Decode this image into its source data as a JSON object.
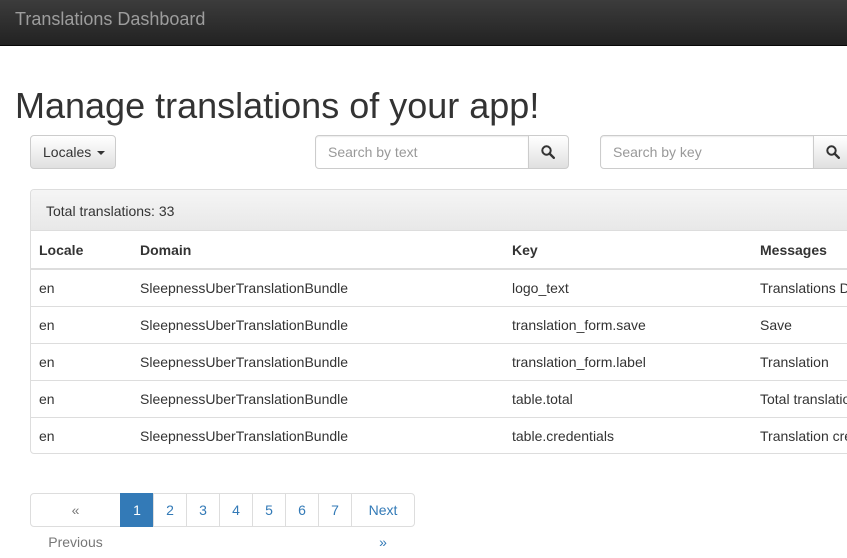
{
  "app": {
    "brand": "Translations Dashboard"
  },
  "page": {
    "title": "Manage translations of your app!"
  },
  "toolbar": {
    "locales_label": "Locales",
    "search_text_placeholder": "Search by text",
    "search_key_placeholder": "Search by key",
    "search_icon": "search-icon"
  },
  "panel": {
    "total_label": "Total translations: 33"
  },
  "table": {
    "columns": [
      "Locale",
      "Domain",
      "Key",
      "Messages"
    ],
    "rows": [
      [
        "en",
        "SleepnessUberTranslationBundle",
        "logo_text",
        "Translations D"
      ],
      [
        "en",
        "SleepnessUberTranslationBundle",
        "translation_form.save",
        "Save"
      ],
      [
        "en",
        "SleepnessUberTranslationBundle",
        "translation_form.label",
        "Translation"
      ],
      [
        "en",
        "SleepnessUberTranslationBundle",
        "table.total",
        "Total translatio"
      ],
      [
        "en",
        "SleepnessUberTranslationBundle",
        "table.credentials",
        "Translation cre"
      ]
    ]
  },
  "pagination": {
    "previous": "« Previous",
    "pages": [
      "1",
      "2",
      "3",
      "4",
      "5",
      "6",
      "7"
    ],
    "active": "1",
    "next": "Next »"
  },
  "colors": {
    "navbar": "#222222",
    "accent": "#337ab7",
    "border": "#dddddd",
    "text": "#333333"
  }
}
